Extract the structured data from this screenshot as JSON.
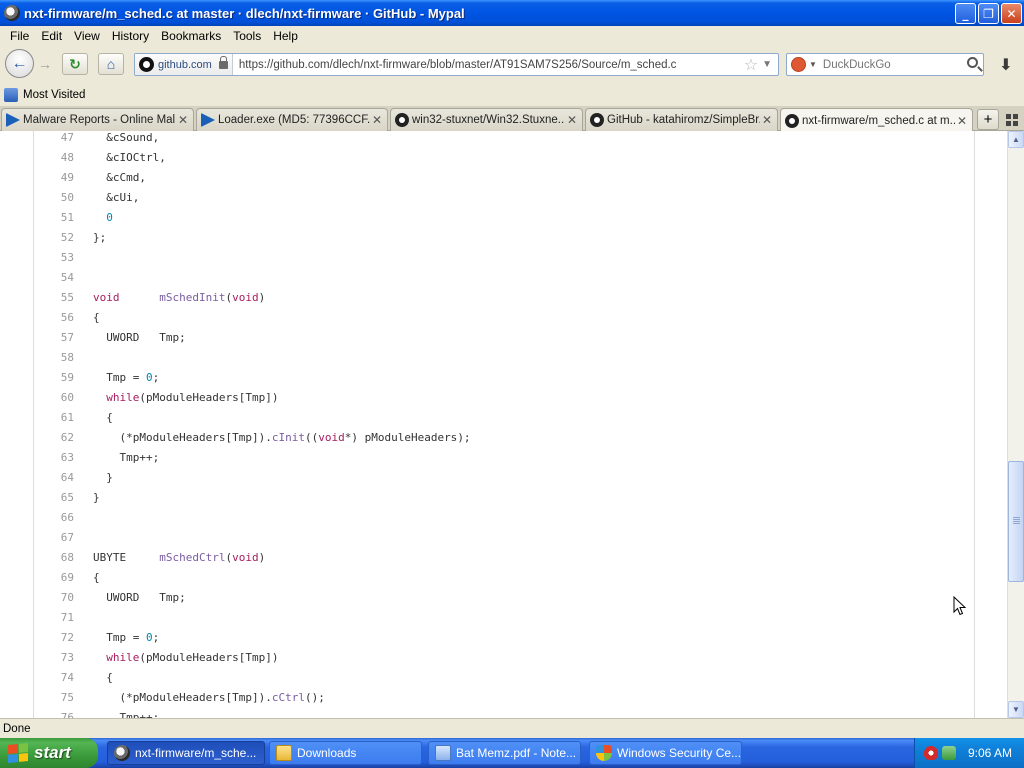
{
  "window": {
    "title": "nxt-firmware/m_sched.c at master · dlech/nxt-firmware · GitHub - Mypal",
    "minimize": "_",
    "maximize": "❐",
    "close": "✕"
  },
  "menu": [
    "File",
    "Edit",
    "View",
    "History",
    "Bookmarks",
    "Tools",
    "Help"
  ],
  "nav": {
    "site_name": "github.com",
    "url": "https://github.com/dlech/nxt-firmware/blob/master/AT91SAM7S256/Source/m_sched.c",
    "search_placeholder": "DuckDuckGo"
  },
  "bookmarks": {
    "most_visited": "Most Visited"
  },
  "tabs": [
    {
      "label": "Malware Reports - Online Mal...",
      "icon": "virustotal-icon"
    },
    {
      "label": "Loader.exe (MD5: 77396CCF...",
      "icon": "virustotal-icon"
    },
    {
      "label": "win32-stuxnet/Win32.Stuxne...",
      "icon": "github-icon"
    },
    {
      "label": "GitHub - katahiromz/SimpleBr...",
      "icon": "github-icon"
    },
    {
      "label": "nxt-firmware/m_sched.c at m...",
      "icon": "github-icon"
    }
  ],
  "code": {
    "lines": [
      {
        "n": "47",
        "t": "  &cSound,"
      },
      {
        "n": "48",
        "t": "  &cIOCtrl,"
      },
      {
        "n": "49",
        "t": "  &cCmd,"
      },
      {
        "n": "50",
        "t": "  &cUi,"
      },
      {
        "n": "51",
        "t": "  0"
      },
      {
        "n": "52",
        "t": "};"
      },
      {
        "n": "53",
        "t": ""
      },
      {
        "n": "54",
        "t": ""
      },
      {
        "n": "55",
        "t": "void      mSchedInit(void)"
      },
      {
        "n": "56",
        "t": "{"
      },
      {
        "n": "57",
        "t": "  UWORD   Tmp;"
      },
      {
        "n": "58",
        "t": ""
      },
      {
        "n": "59",
        "t": "  Tmp = 0;"
      },
      {
        "n": "60",
        "t": "  while(pModuleHeaders[Tmp])"
      },
      {
        "n": "61",
        "t": "  {"
      },
      {
        "n": "62",
        "t": "    (*pModuleHeaders[Tmp]).cInit((void*) pModuleHeaders);"
      },
      {
        "n": "63",
        "t": "    Tmp++;"
      },
      {
        "n": "64",
        "t": "  }"
      },
      {
        "n": "65",
        "t": "}"
      },
      {
        "n": "66",
        "t": ""
      },
      {
        "n": "67",
        "t": ""
      },
      {
        "n": "68",
        "t": "UBYTE     mSchedCtrl(void)"
      },
      {
        "n": "69",
        "t": "{"
      },
      {
        "n": "70",
        "t": "  UWORD   Tmp;"
      },
      {
        "n": "71",
        "t": ""
      },
      {
        "n": "72",
        "t": "  Tmp = 0;"
      },
      {
        "n": "73",
        "t": "  while(pModuleHeaders[Tmp])"
      },
      {
        "n": "74",
        "t": "  {"
      },
      {
        "n": "75",
        "t": "    (*pModuleHeaders[Tmp]).cCtrl();"
      },
      {
        "n": "76",
        "t": "    Tmp++;"
      }
    ],
    "keywords": [
      "void",
      "while"
    ],
    "functions": [
      "mSchedInit",
      "mSchedCtrl",
      "cInit",
      "cCtrl"
    ],
    "colors": {
      "keyword": "#a71d5d",
      "function": "#795da3",
      "number": "#0086b3",
      "text": "#333333",
      "line_number": "#999999"
    }
  },
  "status": {
    "text": "Done"
  },
  "taskbar": {
    "start_label": "start",
    "tasks": [
      {
        "label": "nxt-firmware/m_sche...",
        "icon": "mypal-icon",
        "active": true
      },
      {
        "label": "Downloads",
        "icon": "folder-icon",
        "active": false
      },
      {
        "label": "Bat Memz.pdf - Note...",
        "icon": "notepad-icon",
        "active": false
      },
      {
        "label": "Windows Security Ce...",
        "icon": "security-center-icon",
        "active": false
      }
    ],
    "clock": "9:06 AM"
  }
}
